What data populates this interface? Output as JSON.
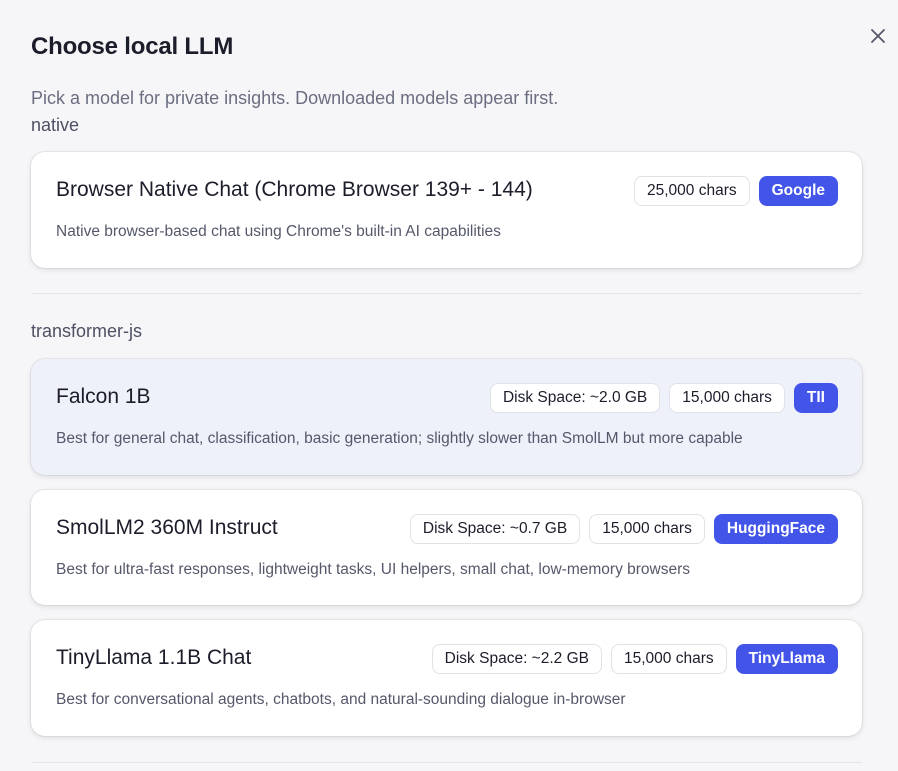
{
  "dialog": {
    "title": "Choose local LLM",
    "subtitle": "Pick a model for private insights. Downloaded models appear first."
  },
  "groups": [
    {
      "label": "native",
      "models": [
        {
          "name": "Browser Native Chat (Chrome Browser 139+ - 144)",
          "description": "Native browser-based chat using Chrome's built-in AI capabilities",
          "chars": "25,000 chars",
          "provider": "Google"
        }
      ]
    },
    {
      "label": "transformer-js",
      "models": [
        {
          "name": "Falcon 1B",
          "description": "Best for general chat, classification, basic generation; slightly slower than SmolLM but more capable",
          "disk": "Disk Space: ~2.0 GB",
          "chars": "15,000 chars",
          "provider": "TII"
        },
        {
          "name": "SmolLM2 360M Instruct",
          "description": "Best for ultra-fast responses, lightweight tasks, UI helpers, small chat, low-memory browsers",
          "disk": "Disk Space: ~0.7 GB",
          "chars": "15,000 chars",
          "provider": "HuggingFace"
        },
        {
          "name": "TinyLlama 1.1B Chat",
          "description": "Best for conversational agents, chatbots, and natural-sounding dialogue in-browser",
          "disk": "Disk Space: ~2.2 GB",
          "chars": "15,000 chars",
          "provider": "TinyLlama"
        }
      ]
    }
  ],
  "colors": {
    "accent": "#4354e8",
    "selected_card": "#eef0fa"
  },
  "icons": {
    "close": "close-icon"
  }
}
